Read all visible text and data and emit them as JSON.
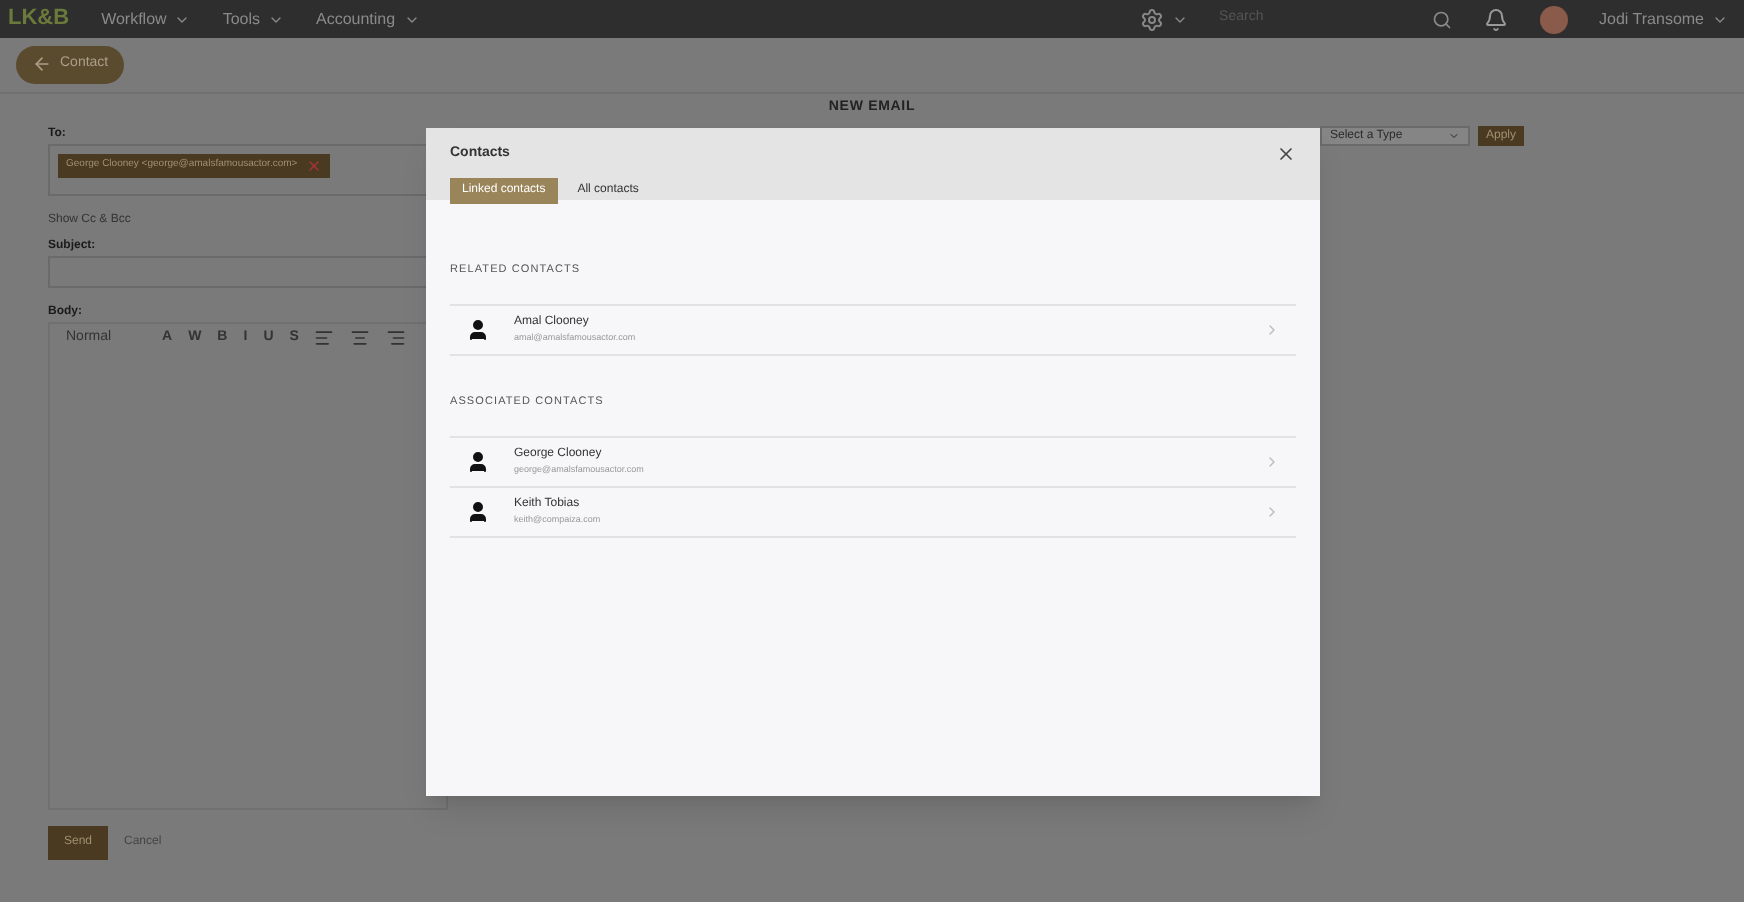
{
  "nav": {
    "logo": "LK&B",
    "menus": [
      {
        "label": "Workflow"
      },
      {
        "label": "Tools"
      },
      {
        "label": "Accounting"
      }
    ],
    "search": {
      "placeholder": "Search"
    },
    "user": "Jodi Transome"
  },
  "back_button": "Contact",
  "page_title": "NEW EMAIL",
  "form": {
    "to_label": "To:",
    "recipients": [
      "George Clooney <george@amalsfamousactor.com>"
    ],
    "cc_link": "Show Cc & Bcc",
    "subject_label": "Subject:",
    "body_label": "Body:",
    "format": "Normal",
    "toolbar": [
      "A",
      "W",
      "B",
      "I",
      "U",
      "S"
    ],
    "type_select": {
      "placeholder": "Select a Type"
    },
    "apply": "Apply",
    "send": "Send",
    "cancel": "Cancel"
  },
  "modal": {
    "title": "Contacts",
    "tabs": [
      {
        "label": "Linked contacts",
        "selected": true
      },
      {
        "label": "All contacts",
        "selected": false
      }
    ],
    "sections": [
      {
        "heading": "RELATED CONTACTS",
        "contacts": [
          {
            "name": "Amal Clooney",
            "email": "amal@amalsfamousactor.com"
          }
        ]
      },
      {
        "heading": "ASSOCIATED CONTACTS",
        "contacts": [
          {
            "name": "George Clooney",
            "email": "george@amalsfamousactor.com"
          },
          {
            "name": "Keith Tobias",
            "email": "keith@compaiza.com"
          }
        ]
      }
    ]
  }
}
